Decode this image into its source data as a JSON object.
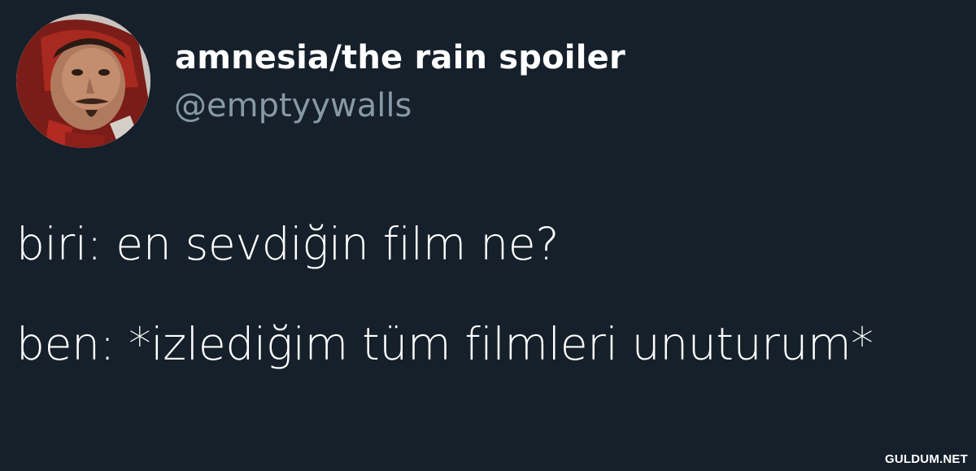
{
  "tweet": {
    "display_name": "amnesia/the rain spoiler",
    "handle": "@emptyywalls",
    "lines": [
      "biri: en sevdiğin film ne?",
      "ben: *izlediğim tüm filmleri unuturum*"
    ]
  },
  "watermark": "GULDUM.NET",
  "colors": {
    "background": "#15202b",
    "primary_text": "#ffffff",
    "secondary_text": "#8899a6"
  }
}
